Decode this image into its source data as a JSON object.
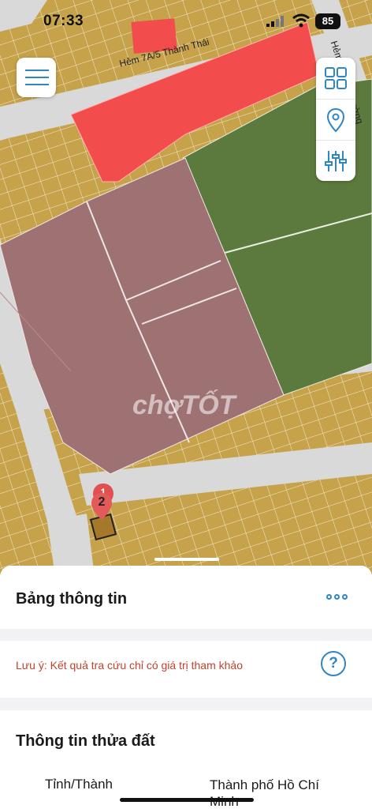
{
  "status_bar": {
    "time": "07:33",
    "battery": "85"
  },
  "map": {
    "streets": [
      "Hẻm 7A/5 Thành Thái",
      "Hẻm",
      "Đường"
    ],
    "watermark": "chợTỐT",
    "markers": [
      "1",
      "2"
    ],
    "colors": {
      "land": "#c6a24a",
      "road": "#d9d9d9",
      "red_zone": "#f24c4c",
      "green_zone": "#5d7a3e",
      "brown_zone": "#9e7272"
    }
  },
  "controls": {
    "menu_icon": "hamburger-icon",
    "tools": [
      "grid-icon",
      "location-pin-icon",
      "sliders-icon"
    ]
  },
  "panel": {
    "title": "Bảng thông tin",
    "note": "Lưu ý: Kết quả tra cứu chỉ có giá trị tham khảo",
    "help_label": "?",
    "section_title": "Thông tin thửa đất",
    "rows": [
      {
        "label": "Tỉnh/Thành",
        "value": "Thành phố Hồ Chí Minh"
      }
    ]
  }
}
